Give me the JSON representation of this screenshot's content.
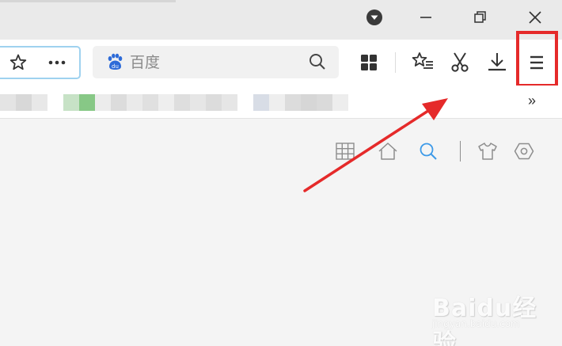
{
  "titlebar": {
    "dropdown_icon": "circle-down-icon",
    "minimize_icon": "minimize-icon",
    "restore_icon": "restore-icon",
    "close_icon": "close-icon"
  },
  "toolbar": {
    "bookmark_star_icon": "star-icon",
    "more_icon": "more-dots-icon",
    "search": {
      "engine_icon": "baidu-paw-icon",
      "placeholder": "百度",
      "search_icon": "magnifier-icon"
    },
    "apps_icon": "grid-apps-icon",
    "favorites_icon": "favorites-list-icon",
    "screenshot_icon": "scissors-icon",
    "download_icon": "download-icon",
    "menu_icon": "hamburger-menu-icon"
  },
  "bookmarks_bar": {
    "overflow_label": "»"
  },
  "new_tab": {
    "icons": [
      "grid-icon",
      "home-icon",
      "search-icon",
      "shirt-skin-icon",
      "settings-hex-icon"
    ]
  },
  "annotation": {
    "highlight_color": "#e52a2a",
    "arrow_color": "#e52a2a"
  },
  "colors": {
    "accent": "#3d9ae8",
    "baidu_blue": "#2d6bd8",
    "titlebar": "#eaeaea",
    "content_bg": "#f4f4f4"
  },
  "watermark": {
    "logo": "Baidu经验",
    "url": "jingyan.baidu.com"
  }
}
